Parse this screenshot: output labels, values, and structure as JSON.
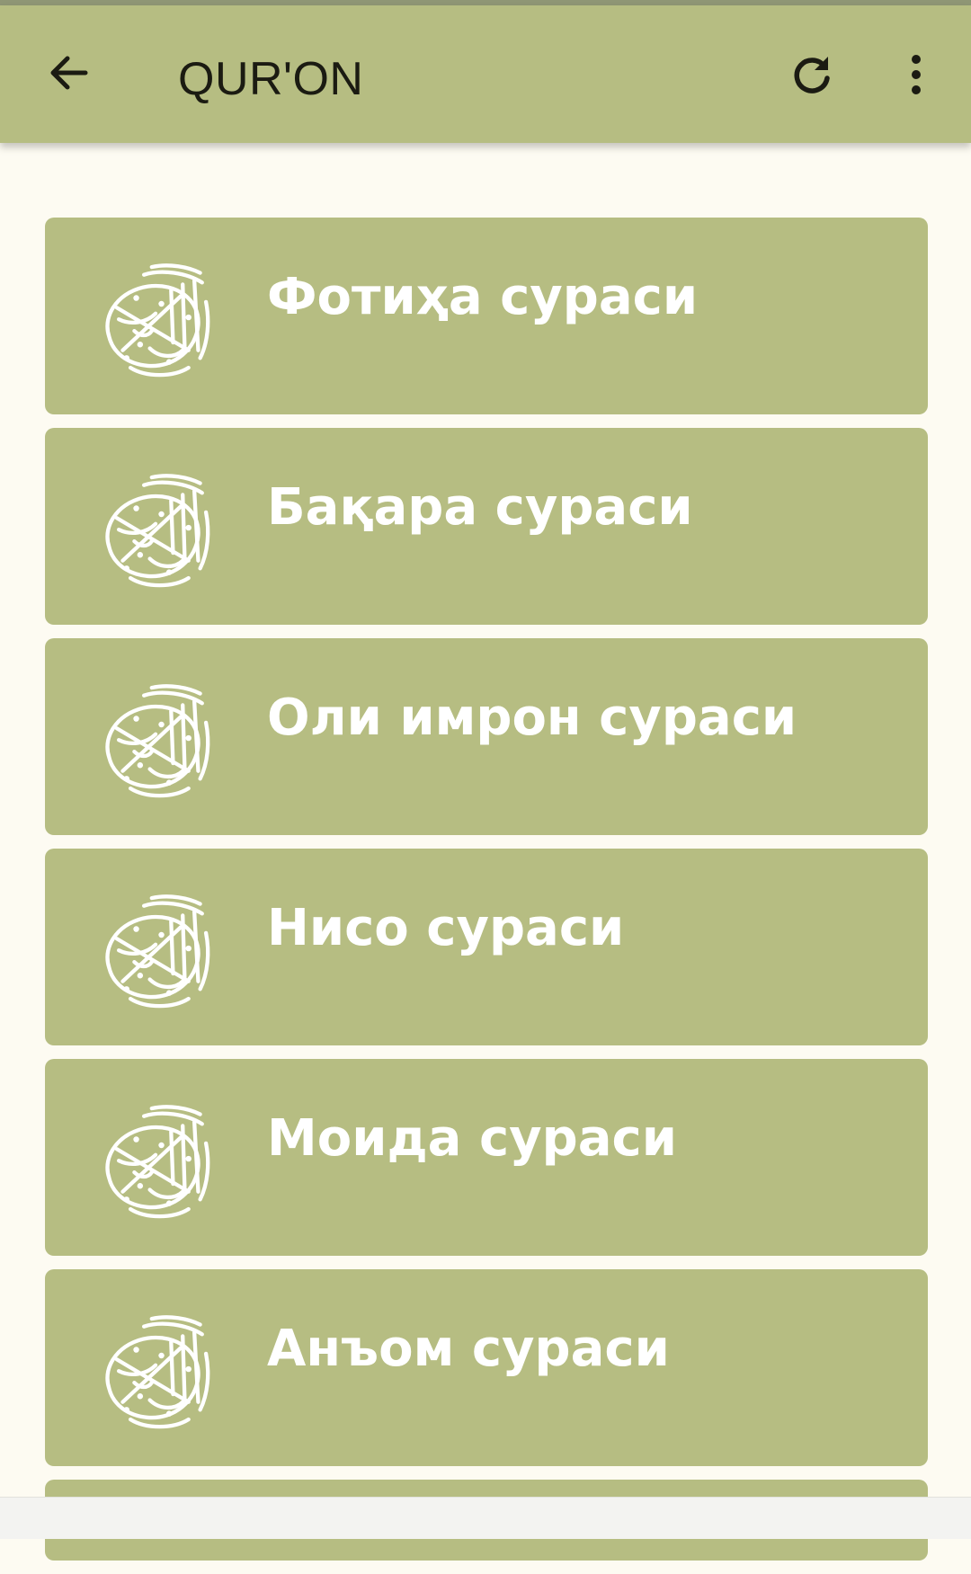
{
  "app_bar": {
    "title": "QUR'ON",
    "back_icon": "arrow-left-icon",
    "refresh_icon": "refresh-icon",
    "more_icon": "more-vertical-icon"
  },
  "surahs": [
    {
      "label": "Фотиҳа сураси"
    },
    {
      "label": "Бақара сураси"
    },
    {
      "label": "Оли имрон сураси"
    },
    {
      "label": "Нисо сураси"
    },
    {
      "label": "Моида сураси"
    },
    {
      "label": "Анъом сураси"
    }
  ],
  "colors": {
    "app_bar": "#b6bd82",
    "item_background": "#b6bd82",
    "page_background": "#fdfbf2",
    "title_text": "#1b1b12",
    "item_text": "#ffffff"
  }
}
